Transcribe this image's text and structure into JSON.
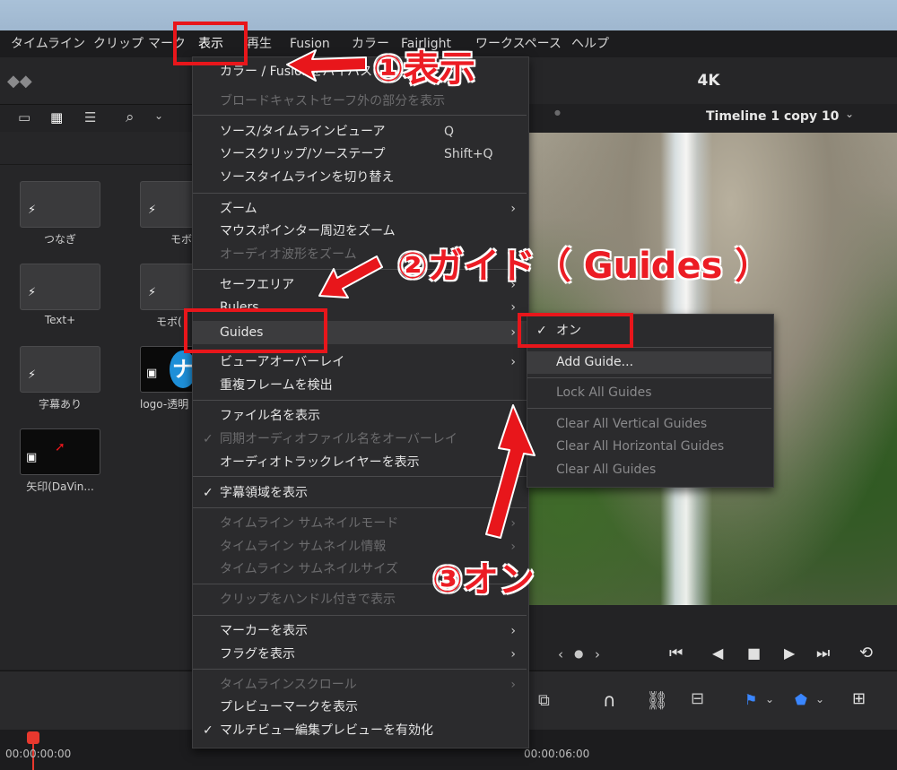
{
  "menubar": {
    "items": [
      "タイムライン",
      "クリップ",
      "マーク",
      "表示",
      "再生",
      "Fusion",
      "カラー",
      "Fairlight",
      "ワークスペース",
      "ヘルプ"
    ]
  },
  "viewer": {
    "title": "4K",
    "timeline_name": "Timeline 1 copy 10"
  },
  "media_pool": {
    "clips": [
      {
        "label": "つなぎ"
      },
      {
        "label": "モボ"
      },
      {
        "label": "Text+"
      },
      {
        "label": "モボ("
      },
      {
        "label": "字幕あり"
      },
      {
        "label": "logo-透明"
      },
      {
        "label": "矢印(DaVin..."
      }
    ]
  },
  "view_menu": {
    "items": [
      {
        "label": "カラー / Fusionをバイパス",
        "state": "enabled"
      },
      {
        "label": "ブロードキャストセーフ外の部分を表示",
        "state": "disabled"
      },
      {
        "label": "ソース/タイムラインビューア",
        "shortcut": "Q"
      },
      {
        "label": "ソースクリップ/ソーステープ",
        "shortcut": "Shift+Q"
      },
      {
        "label": "ソースタイムラインを切り替え"
      },
      {
        "label": "ズーム",
        "submenu": true
      },
      {
        "label": "マウスポインター周辺をズーム"
      },
      {
        "label": "オーディオ波形をズーム",
        "state": "disabled"
      },
      {
        "label": "セーフエリア",
        "submenu": true
      },
      {
        "label": "Rulers",
        "submenu": true
      },
      {
        "label": "Guides",
        "submenu": true,
        "highlighted": true
      },
      {
        "label": "ビューアオーバーレイ",
        "submenu": true
      },
      {
        "label": "重複フレームを検出"
      },
      {
        "label": "ファイル名を表示"
      },
      {
        "label": "同期オーディオファイル名をオーバーレイ",
        "state": "disabled",
        "checked": true
      },
      {
        "label": "オーディオトラックレイヤーを表示"
      },
      {
        "label": "字幕領域を表示",
        "checked": true
      },
      {
        "label": "タイムライン サムネイルモード",
        "state": "disabled",
        "submenu": true
      },
      {
        "label": "タイムライン サムネイル情報",
        "state": "disabled",
        "submenu": true
      },
      {
        "label": "タイムライン サムネイルサイズ",
        "state": "disabled",
        "submenu": true
      },
      {
        "label": "クリップをハンドル付きで表示",
        "state": "disabled"
      },
      {
        "label": "マーカーを表示",
        "submenu": true
      },
      {
        "label": "フラグを表示",
        "submenu": true
      },
      {
        "label": "タイムラインスクロール",
        "state": "disabled",
        "submenu": true
      },
      {
        "label": "プレビューマークを表示"
      },
      {
        "label": "マルチビュー編集プレビューを有効化",
        "checked": true
      }
    ]
  },
  "guides_submenu": {
    "items": [
      {
        "label": "オン",
        "checked": true
      },
      {
        "label": "Add Guide...",
        "highlighted": true
      },
      {
        "label": "Lock All Guides",
        "state": "disabled"
      },
      {
        "label": "Clear All Vertical Guides",
        "state": "disabled"
      },
      {
        "label": "Clear All Horizontal Guides",
        "state": "disabled"
      },
      {
        "label": "Clear All Guides",
        "state": "disabled"
      }
    ]
  },
  "timecodes": {
    "start": "00:00:00:00",
    "mid": "00:00:06:00"
  },
  "annotations": {
    "step1": "①表示",
    "step2": "②ガイド（ Guides ）",
    "step3": "③オン",
    "color": "#ec1c24"
  }
}
